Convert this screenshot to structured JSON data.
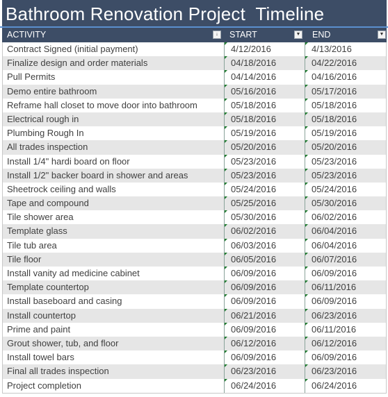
{
  "title": "Bathroom Renovation Project  Timeline",
  "colors": {
    "header_bg": "#3d4d66",
    "accent_line": "#5b8fcf",
    "alt_row_bg": "#e6e6e6",
    "text": "#404040",
    "error_indicator": "#1f7a2e"
  },
  "columns": {
    "activity": {
      "label": "ACTIVITY",
      "filter_icon": "sort-filter-icon"
    },
    "start": {
      "label": "START",
      "filter_icon": "dropdown-filter-icon"
    },
    "end": {
      "label": "END",
      "filter_icon": "dropdown-filter-icon"
    }
  },
  "rows": [
    {
      "activity": "Contract Signed (initial payment)",
      "start": "4/12/2016",
      "end": "4/13/2016"
    },
    {
      "activity": "Finalize design and order materials",
      "start": "04/18/2016",
      "end": "04/22/2016"
    },
    {
      "activity": "Pull Permits",
      "start": "04/14/2016",
      "end": "04/16/2016"
    },
    {
      "activity": "Demo entire bathroom",
      "start": "05/16/2016",
      "end": "05/17/2016"
    },
    {
      "activity": "Reframe hall closet to move door into bathroom",
      "start": "05/18/2016",
      "end": "05/18/2016"
    },
    {
      "activity": "Electrical rough in",
      "start": "05/18/2016",
      "end": "05/18/2016"
    },
    {
      "activity": "Plumbing Rough In",
      "start": "05/19/2016",
      "end": "05/19/2016"
    },
    {
      "activity": "All trades inspection",
      "start": "05/20/2016",
      "end": "05/20/2016"
    },
    {
      "activity": "Install 1/4\" hardi board on floor",
      "start": "05/23/2016",
      "end": "05/23/2016"
    },
    {
      "activity": "Install 1/2\" backer board in shower and areas",
      "start": "05/23/2016",
      "end": "05/23/2016"
    },
    {
      "activity": "Sheetrock ceiling and walls",
      "start": "05/24/2016",
      "end": "05/24/2016"
    },
    {
      "activity": "Tape and compound",
      "start": "05/25/2016",
      "end": "05/30/2016"
    },
    {
      "activity": "Tile shower area",
      "start": "05/30/2016",
      "end": "06/02/2016"
    },
    {
      "activity": "Template glass",
      "start": "06/02/2016",
      "end": "06/04/2016"
    },
    {
      "activity": "Tile tub area",
      "start": "06/03/2016",
      "end": "06/04/2016"
    },
    {
      "activity": "Tile floor",
      "start": "06/05/2016",
      "end": "06/07/2016"
    },
    {
      "activity": "Install vanity ad medicine cabinet",
      "start": "06/09/2016",
      "end": "06/09/2016"
    },
    {
      "activity": "Template countertop",
      "start": "06/09/2016",
      "end": "06/11/2016"
    },
    {
      "activity": "Install baseboard and casing",
      "start": "06/09/2016",
      "end": "06/09/2016"
    },
    {
      "activity": "Install countertop",
      "start": "06/21/2016",
      "end": "06/23/2016"
    },
    {
      "activity": "Prime and paint",
      "start": "06/09/2016",
      "end": "06/11/2016"
    },
    {
      "activity": "Grout shower, tub, and floor",
      "start": "06/12/2016",
      "end": "06/12/2016"
    },
    {
      "activity": "Install towel bars",
      "start": "06/09/2016",
      "end": "06/09/2016"
    },
    {
      "activity": "Final all trades inspection",
      "start": "06/23/2016",
      "end": "06/23/2016"
    },
    {
      "activity": "Project completion",
      "start": "06/24/2016",
      "end": "06/24/2016"
    }
  ]
}
